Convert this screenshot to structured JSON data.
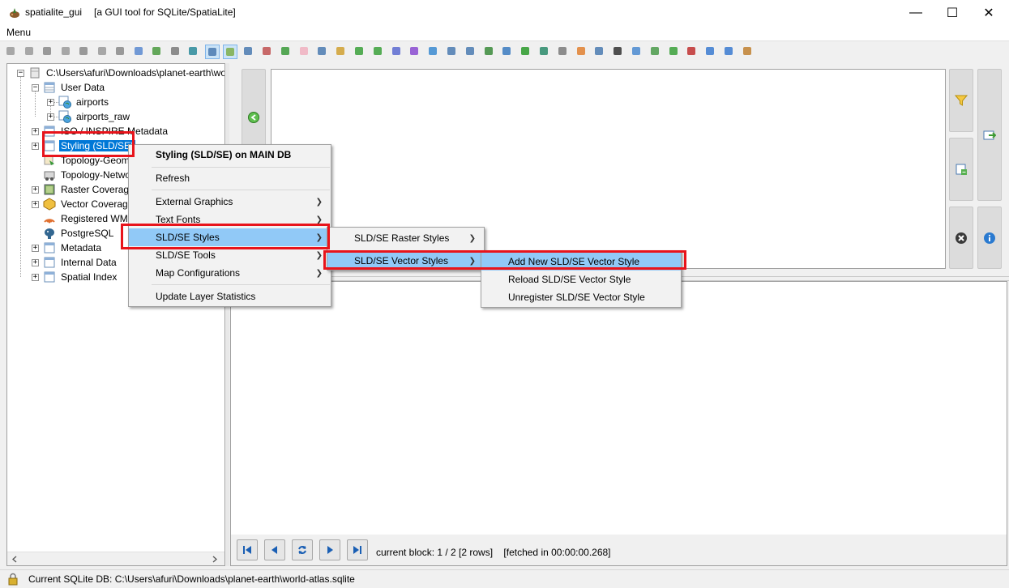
{
  "window": {
    "app_name": "spatialite_gui",
    "subtitle": "[a GUI tool for SQLite/SpatiaLite]",
    "minimize_glyph": "—",
    "maximize_glyph": "☐",
    "close_glyph": "✕"
  },
  "menubar": {
    "menu_label": "Menu"
  },
  "tree": {
    "root": "C:\\Users\\afuri\\Downloads\\planet-earth\\world-atlas.sqlite",
    "user_data": "User Data",
    "airports": "airports",
    "airports_raw": "airports_raw",
    "iso_metadata": "ISO / INSPIRE Metadata",
    "styling": "Styling (SLD/SE)",
    "topology_geom": "Topology-Geometries",
    "topology_network": "Topology-Networks",
    "raster_coverages": "Raster Coverages",
    "vector_coverages": "Vector Coverages",
    "registered_wms": "Registered WMS",
    "postgresql": "PostgreSQL",
    "metadata": "Metadata",
    "internal_data": "Internal Data",
    "spatial_index": "Spatial Index"
  },
  "context_menu": {
    "header": "Styling (SLD/SE) on MAIN DB",
    "refresh": "Refresh",
    "external_graphics": "External Graphics",
    "text_fonts": "Text Fonts",
    "sld_se_styles": "SLD/SE Styles",
    "sld_se_tools": "SLD/SE Tools",
    "map_configurations": "Map Configurations",
    "update_layer_statistics": "Update Layer Statistics"
  },
  "styles_submenu": {
    "raster_styles": "SLD/SE Raster Styles",
    "vector_styles": "SLD/SE Vector Styles"
  },
  "vector_submenu": {
    "add": "Add New SLD/SE Vector Style",
    "reload": "Reload SLD/SE Vector Style",
    "unregister": "Unregister SLD/SE Vector Style"
  },
  "results": {
    "block_info": "current block: 1 / 2 [2 rows]",
    "fetch_info": "[fetched in 00:00:00.268]"
  },
  "statusbar": {
    "text": "Current SQLite DB: C:\\Users\\afuri\\Downloads\\planet-earth\\world-atlas.sqlite"
  },
  "colors": {
    "selection": "#0078d7",
    "menu_highlight": "#91c9f7",
    "annotation_red": "#e8141b"
  }
}
